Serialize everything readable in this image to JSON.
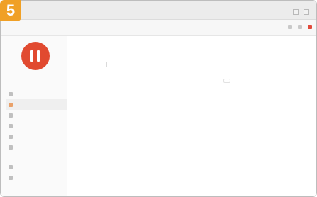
{
  "step": "5",
  "window": {
    "title": "",
    "subtitle": ""
  },
  "toolbar": {
    "brand": "",
    "breadcrumb": ""
  },
  "user": {
    "name": "",
    "role": ""
  },
  "sidebar": {
    "items": [
      {
        "label": "",
        "icon": "dashboard-icon"
      },
      {
        "label": "",
        "icon": "users-icon"
      },
      {
        "label": "",
        "icon": "folder-icon"
      },
      {
        "label": "",
        "icon": "chart-icon"
      },
      {
        "label": "",
        "icon": "calendar-icon"
      },
      {
        "label": "",
        "icon": "list-icon"
      },
      {
        "label": "",
        "icon": "settings-icon"
      },
      {
        "label": "",
        "icon": "logout-icon"
      }
    ]
  },
  "panel": {
    "title": "",
    "fields": [
      {
        "label": "",
        "value": ""
      },
      {
        "label": "",
        "value": ""
      },
      {
        "label": "",
        "value": ""
      }
    ]
  },
  "filters": {
    "options": [
      "",
      "",
      "",
      ""
    ]
  },
  "empty_state": {
    "message": "",
    "link": ""
  },
  "colors": {
    "accent": "#f0a026",
    "avatar": "#e14a30",
    "close_button": "#e14a3b"
  }
}
